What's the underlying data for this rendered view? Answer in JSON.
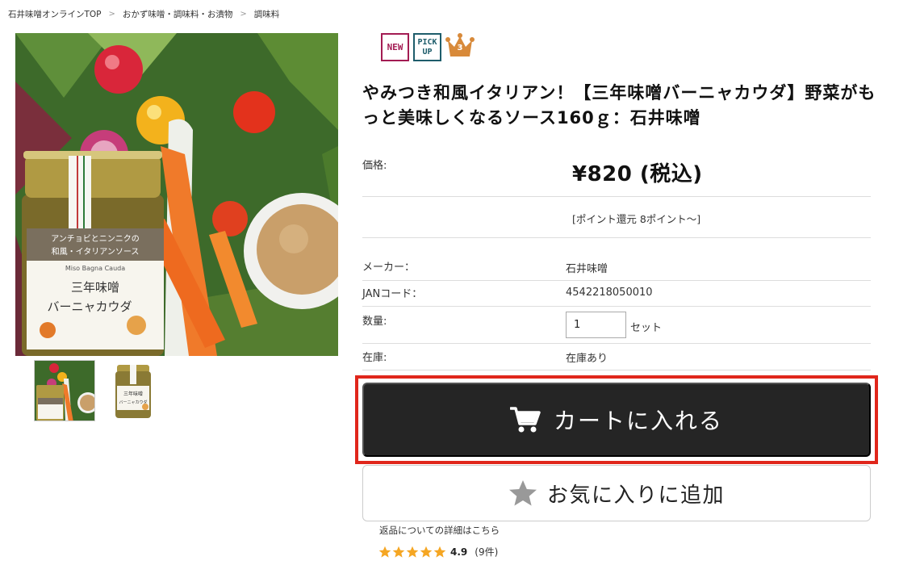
{
  "breadcrumb": {
    "items": [
      "石井味噌オンラインTOP",
      "おかず味噌・調味料・お漬物",
      "調味料"
    ],
    "separator": ">"
  },
  "product_image": {
    "jar_label_top": "アンチョビとニンニクの\n和風・イタリアンソース",
    "jar_label_sub": "Miso Bagna Cauda",
    "jar_label_main_1": "三年味噌",
    "jar_label_main_2": "バーニャカウダ",
    "thumb_label_1": "三年味噌",
    "thumb_label_2": "バーニャカウダ"
  },
  "badges": {
    "new": "NEW",
    "pickup_1": "PICK",
    "pickup_2": "UP",
    "rank": "3"
  },
  "product": {
    "title": "やみつき和風イタリアン！【三年味噌バーニャカウダ】野菜がもっと美味しくなるソース160ｇ：石井味噌",
    "price_label": "価格:",
    "price": "¥820 (税込)",
    "points": "[ポイント還元 8ポイント〜]",
    "maker_label": "メーカー：",
    "maker": "石井味噌",
    "jan_label": "JANコード：",
    "jan": "4542218050010",
    "qty_label": "数量:",
    "qty_value": "1",
    "qty_unit": "セット",
    "stock_label": "在庫:",
    "stock": "在庫あり"
  },
  "actions": {
    "cart": "カートに入れる",
    "favorite": "お気に入りに追加",
    "highlight_color": "#e0261b"
  },
  "footer": {
    "return_link": "返品についての詳細はこちら",
    "rating_score": "4.9",
    "rating_count": "(9件)",
    "star_color": "#f5a623"
  }
}
